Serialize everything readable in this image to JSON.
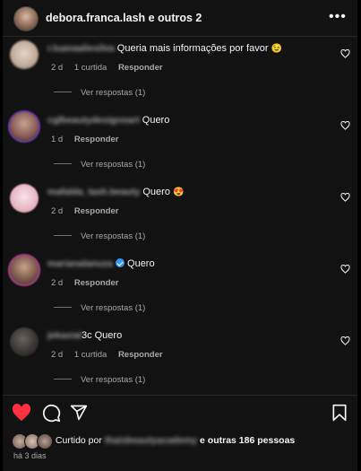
{
  "header": {
    "title": "debora.franca.lash e outros 2",
    "more_label": "•••"
  },
  "comments": [
    {
      "username": "r.luanaaliesilva",
      "text": "Queria mais informações por favor",
      "emoji": "😉",
      "time": "2 d",
      "likes": "1 curtida",
      "reply_label": "Responder",
      "view_replies": "Ver respostas (1)",
      "avatar_color": "#c9b8a8"
    },
    {
      "username": "cglbeautydesignoart",
      "text": "Quero",
      "emoji": "",
      "time": "1 d",
      "likes": "",
      "reply_label": "Responder",
      "view_replies": "Ver respostas (1)",
      "avatar_color": "#a8847a"
    },
    {
      "username": "mafalda_lash.beauty",
      "text": "Quero",
      "emoji": "😍",
      "time": "2 d",
      "likes": "",
      "reply_label": "Responder",
      "view_replies": "Ver respostas (1)",
      "avatar_color": "#e8c6cf"
    },
    {
      "username": "marianalanuza",
      "text": "Quero",
      "emoji": "",
      "verified": true,
      "time": "2 d",
      "likes": "",
      "reply_label": "Responder",
      "view_replies": "Ver respostas (1)",
      "avatar_color": "#7a5a55"
    },
    {
      "username": "jekaxial",
      "text": "3c Quero",
      "emoji": "",
      "time": "2 d",
      "likes": "1 curtida",
      "reply_label": "Responder",
      "view_replies": "Ver respostas (1)",
      "avatar_color": "#3a3a3a"
    }
  ],
  "actions": {
    "like_color": "#ff3040",
    "like_icon": "heart-filled-icon",
    "comment_icon": "comment-icon",
    "share_icon": "share-icon",
    "save_icon": "bookmark-icon"
  },
  "likes_line": {
    "prefix": "Curtido por",
    "blurred_user": "thaisbeautyacademy",
    "suffix": "e outras 186 pessoas"
  },
  "time_ago": "há 3 dias"
}
